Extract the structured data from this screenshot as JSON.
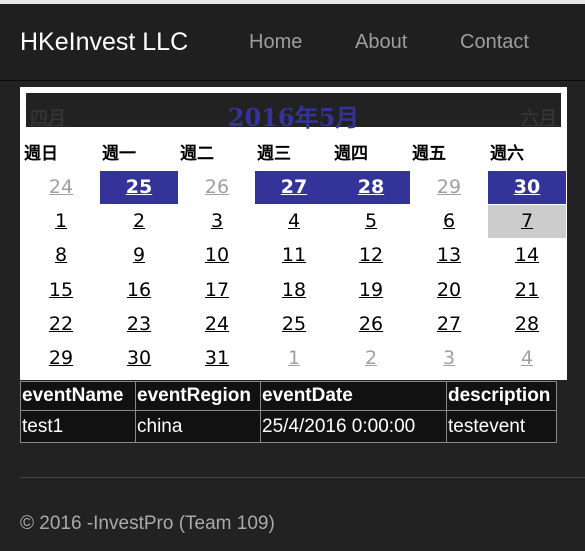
{
  "navbar": {
    "brand": "HKeInvest LLC",
    "links": [
      "Home",
      "About",
      "Contact"
    ]
  },
  "calendar": {
    "prev_label": "四月",
    "title": "2016年5月",
    "next_label": "六月",
    "weekdays": [
      "週日",
      "週一",
      "週二",
      "週三",
      "週四",
      "週五",
      "週六"
    ],
    "weeks": [
      [
        "24",
        "25",
        "26",
        "27",
        "28",
        "29",
        "30"
      ],
      [
        "1",
        "2",
        "3",
        "4",
        "5",
        "6",
        "7"
      ],
      [
        "8",
        "9",
        "10",
        "11",
        "12",
        "13",
        "14"
      ],
      [
        "15",
        "16",
        "17",
        "18",
        "19",
        "20",
        "21"
      ],
      [
        "22",
        "23",
        "24",
        "25",
        "26",
        "27",
        "28"
      ],
      [
        "29",
        "30",
        "31",
        "1",
        "2",
        "3",
        "4"
      ]
    ],
    "colors": {
      "highlight": "#333399",
      "selected": "#cccccc",
      "other_month": "#a0a0a0"
    }
  },
  "events_table": {
    "headers": [
      "eventName",
      "eventRegion",
      "eventDate",
      "description"
    ],
    "rows": [
      [
        "test1",
        "china",
        "25/4/2016 0:00:00",
        "testevent"
      ]
    ]
  },
  "footer": {
    "text": "© 2016 -InvestPro (Team 109)"
  }
}
